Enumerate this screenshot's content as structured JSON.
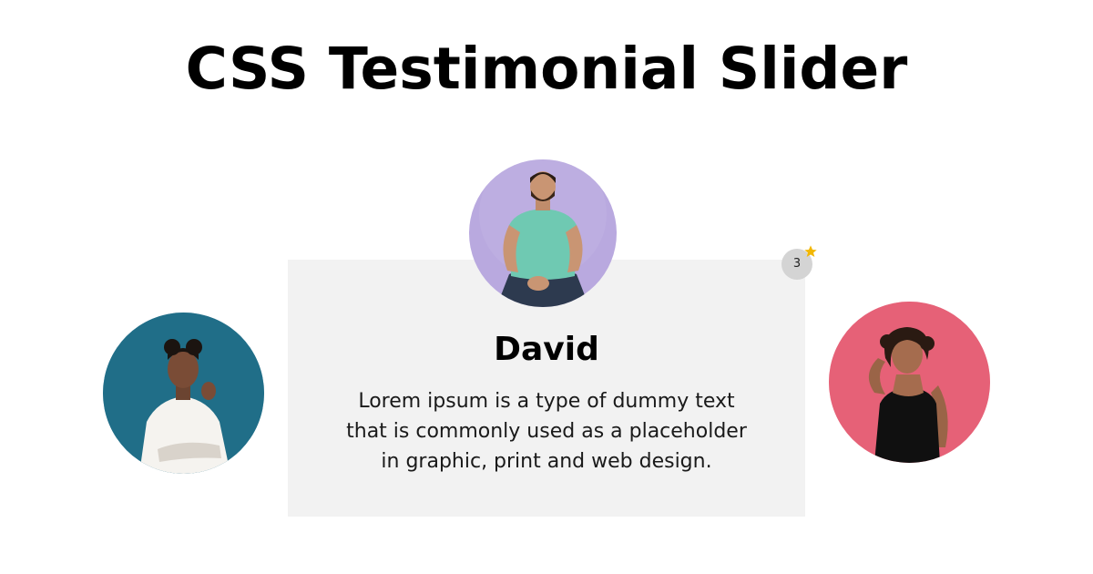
{
  "page": {
    "title": "CSS Testimonial Slider"
  },
  "testimonial": {
    "name": "David",
    "lines": [
      "Lorem ipsum is a type of dummy text",
      "that is commonly used as a placeholder",
      "in graphic, print and web design."
    ]
  },
  "badge": {
    "count": "3",
    "icon": "star-icon"
  },
  "avatars": {
    "main": {
      "icon": "person-photo",
      "background": "#b9a9df"
    },
    "left": {
      "icon": "person-photo",
      "background": "#1d6b86"
    },
    "right": {
      "icon": "person-photo",
      "background": "#e35a71"
    }
  },
  "colors": {
    "card_background": "#f2f2f2",
    "badge_background": "#d4d4d4",
    "star": "#f2b705"
  }
}
